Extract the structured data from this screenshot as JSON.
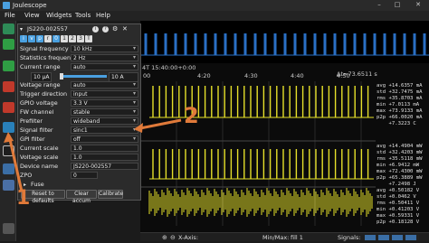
{
  "window": {
    "title": "Joulescope"
  },
  "menu": [
    "File",
    "View",
    "Widgets",
    "Tools",
    "Help"
  ],
  "device": {
    "serial": "JS220-002557"
  },
  "signal_toggles": [
    "i",
    "v",
    "p",
    "r",
    "0",
    "1",
    "2",
    "3",
    "T"
  ],
  "settings": {
    "rows": [
      {
        "label": "Signal frequency",
        "value": "10 kHz"
      },
      {
        "label": "Statistics frequency",
        "value": "2 Hz"
      },
      {
        "label": "Current range",
        "value": "auto"
      },
      {
        "label": "Voltage range",
        "value": "auto"
      },
      {
        "label": "Trigger direction",
        "value": "input"
      },
      {
        "label": "GPIO voltage",
        "value": "3.3 V"
      },
      {
        "label": "FW channel",
        "value": "stable"
      },
      {
        "label": "Prefilter",
        "value": "wideband"
      },
      {
        "label": "Signal filter",
        "value": "sinc1"
      },
      {
        "label": "GPI filter",
        "value": "off"
      },
      {
        "label": "Current scale",
        "value": "1.0"
      },
      {
        "label": "Voltage scale",
        "value": "1.0"
      },
      {
        "label": "Device name",
        "value": "JS220-002557"
      },
      {
        "label": "ZPO",
        "value": "0"
      }
    ],
    "current_slider": {
      "min_label": "10 µA",
      "max_label": "10 A"
    },
    "fuse_label": "Fuse",
    "buttons": {
      "reset": "Reset to defaults",
      "clear": "Clear accum",
      "calibrate": "Calibrate"
    }
  },
  "waveform": {
    "time_header": "4T 15:40:00+0:00",
    "delta_t": "Δt=73.6511 s",
    "x_ticks": [
      "4:20",
      "4:30",
      "4:40",
      "4:50"
    ],
    "left_tick": "00"
  },
  "stats": [
    {
      "avg": "+14.6357 mA",
      "std": "+32.7475 mA",
      "rms": "+35.8703 mA",
      "min": "+7.0113 mA",
      "max": "+73.9133 mA",
      "p2p": "+66.0020 mA",
      "extra": "+7.3223 C"
    },
    {
      "avg": "+14.4904 mW",
      "std": "+32.4203 mW",
      "rms": "+35.5118 mW",
      "min": "+6.9412 mW",
      "max": "+72.4300 mW",
      "p2p": "+65.3889 mW",
      "extra": "+7.2498 J"
    },
    {
      "avg": "+0.50182 V",
      "std": "+0.0462 V",
      "rms": "+0.50411 V",
      "min": "+0.41203 V",
      "max": "+0.59331 V",
      "p2p": "+0.18128 V"
    }
  ],
  "footer": {
    "xaxis": "X-Axis:",
    "minmax": "Min/Max:",
    "fill": "fill 1",
    "signals": "Signals:"
  },
  "annotations": {
    "arrow1": "1",
    "arrow2": "2"
  },
  "colors": {
    "trace": "#e6e02a",
    "overview": "#2a6fc4",
    "annotation": "#e07a3a",
    "accent": "#4aa0e0"
  }
}
